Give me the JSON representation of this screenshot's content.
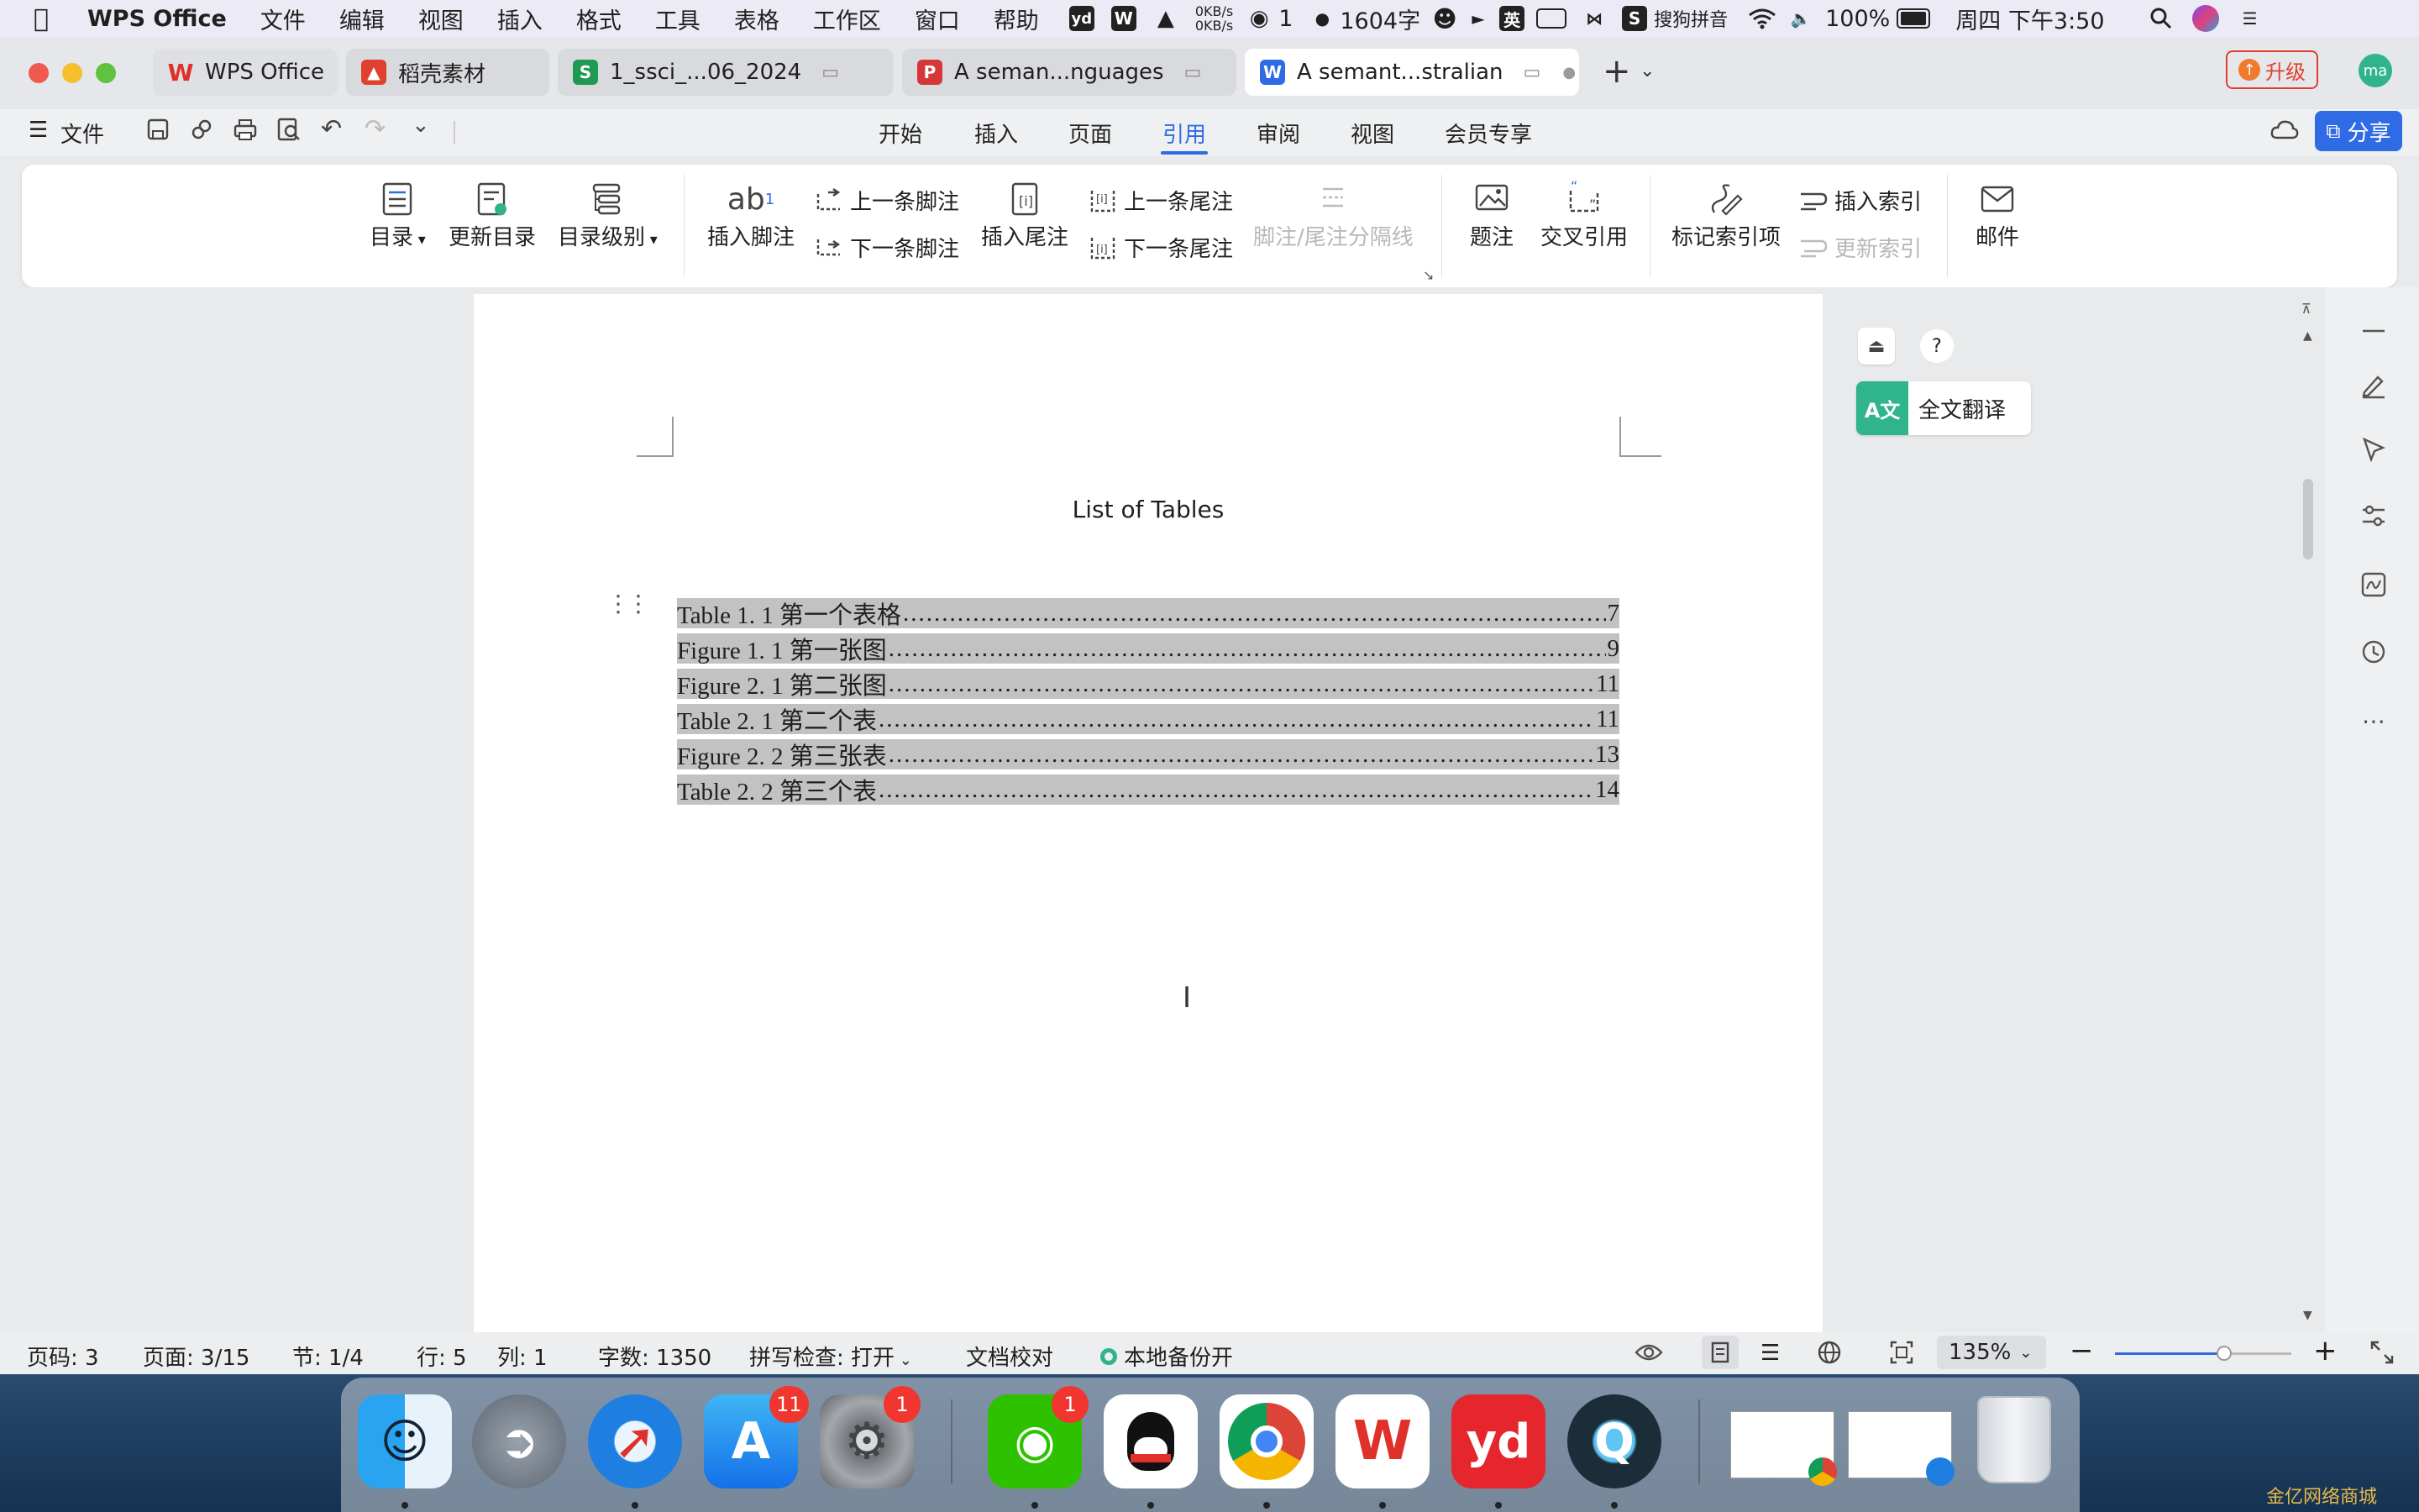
{
  "menubar": {
    "app": "WPS Office",
    "items": [
      "文件",
      "编辑",
      "视图",
      "插入",
      "格式",
      "工具",
      "表格",
      "工作区",
      "窗口",
      "帮助"
    ],
    "net_up": "0KB/s",
    "net_down": "0KB/s",
    "wechat_count": "1",
    "word_count": "1604字",
    "input_lang": "英",
    "ime": "搜狗拼音",
    "battery": "100%",
    "datetime": "周四 下午3:50"
  },
  "tabs": [
    {
      "label": "WPS Office",
      "icon": "W"
    },
    {
      "label": "稻壳素材",
      "icon": "稻"
    },
    {
      "label": "1_ssci_...06_2024",
      "icon": "S"
    },
    {
      "label": "A seman...nguages",
      "icon": "P"
    },
    {
      "label": "A semant...stralian",
      "icon": "W"
    }
  ],
  "upgrade_label": "升级",
  "avatar_label": "ma",
  "toolbar": {
    "file_label": "文件",
    "share_label": "分享",
    "menu_tabs": [
      "开始",
      "插入",
      "页面",
      "引用",
      "审阅",
      "视图",
      "会员专享"
    ],
    "active_tab": "引用"
  },
  "ribbon": {
    "toc": "目录",
    "update_toc": "更新目录",
    "toc_level": "目录级别",
    "insert_footnote": "插入脚注",
    "prev_footnote": "上一条脚注",
    "next_footnote": "下一条脚注",
    "insert_endnote": "插入尾注",
    "prev_endnote": "上一条尾注",
    "next_endnote": "下一条尾注",
    "note_separator": "脚注/尾注分隔线",
    "caption": "题注",
    "cross_ref": "交叉引用",
    "mark_index": "标记索引项",
    "insert_index": "插入索引",
    "update_index": "更新索引",
    "mail": "邮件"
  },
  "document": {
    "title": "List of Tables",
    "entries": [
      {
        "label": "Table 1. 1    第一个表格",
        "page": "7"
      },
      {
        "label": "Figure 1. 1  第一张图",
        "page": "9"
      },
      {
        "label": "Figure 2. 1  第二张图",
        "page": "11"
      },
      {
        "label": "Table 2. 1  第二个表",
        "page": "11"
      },
      {
        "label": "Figure 2. 2  第三张表",
        "page": "13"
      },
      {
        "label": "Table 2. 2  第三个表",
        "page": "14"
      }
    ]
  },
  "translate_label": "全文翻译",
  "help_label": "?",
  "status": {
    "page_code": "页码: 3",
    "page": "页面: 3/15",
    "section": "节: 1/4",
    "row": "行: 5",
    "col": "列: 1",
    "words": "字数: 1350",
    "spell": "拼写检查: 打开",
    "proof": "文档校对",
    "backup": "本地备份开",
    "zoom": "135%",
    "zoom_level": 0.62
  },
  "dock": {
    "appstore_badge": "11",
    "settings_badge": "1",
    "wechat_badge": "1"
  },
  "watermark": "金亿网络商城"
}
